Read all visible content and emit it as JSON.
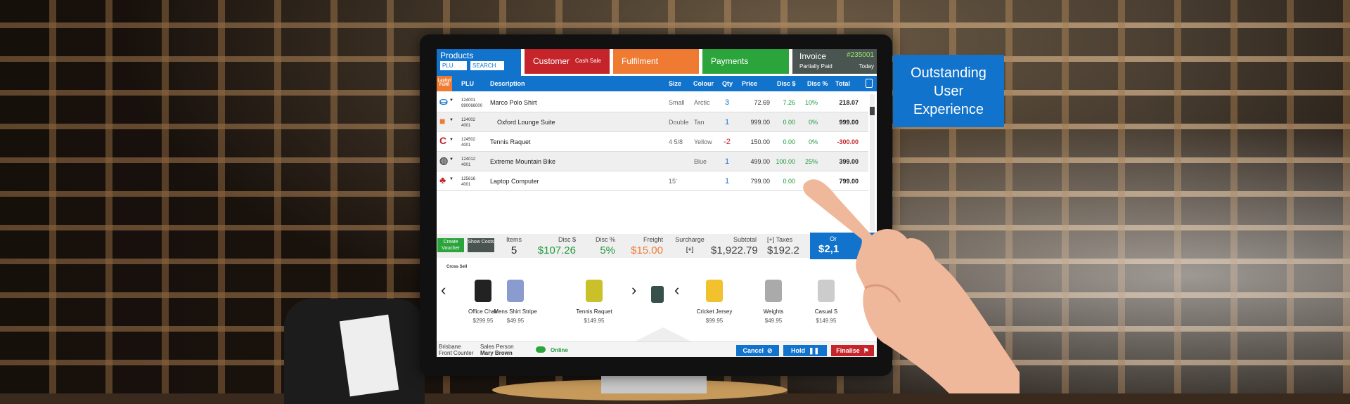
{
  "callout": {
    "line1": "Outstanding",
    "line2": "User",
    "line3": "Experience"
  },
  "tabs": {
    "products": {
      "label": "Products",
      "plu": "PLU",
      "search": "SEARCH",
      "color": "#1173cc"
    },
    "customer": {
      "label": "Customer",
      "sub": "Cash Sale",
      "color": "#c4242a"
    },
    "fulfilment": {
      "label": "Fulfilment",
      "color": "#ef7b33"
    },
    "payments": {
      "label": "Payments",
      "color": "#2ca43c"
    },
    "invoice": {
      "label": "Invoice",
      "number": "#235001",
      "status": "Partially Paid",
      "date": "Today",
      "color": "#4a5552"
    }
  },
  "columns": {
    "layby": "Layby/ Fulfil",
    "plu": "PLU",
    "description": "Description",
    "size": "Size",
    "colour": "Colour",
    "qty": "Qty",
    "price": "Price",
    "disc_amt": "Disc $",
    "disc_pct": "Disc %",
    "total": "Total"
  },
  "rows": [
    {
      "icon": "basket-icon",
      "plu1": "124001",
      "plu2": "990066000",
      "desc": "Marco Polo Shirt",
      "size": "Small",
      "colour": "Arctic",
      "qty": "3",
      "price": "72.69",
      "disc": "7.26",
      "pct": "10%",
      "total": "218.07"
    },
    {
      "icon": "truck-icon",
      "plu1": "124002",
      "plu2": "4001",
      "desc": "Oxford Lounge Suite",
      "size": "Double",
      "colour": "Tan",
      "qty": "1",
      "price": "999.00",
      "disc": "0.00",
      "pct": "0%",
      "total": "999.00"
    },
    {
      "icon": "return-icon",
      "plu1": "124502",
      "plu2": "4001",
      "desc": "Tennis Raquet",
      "size": "4 5/8",
      "colour": "Yellow",
      "qty": "-2",
      "price": "150.00",
      "disc": "0.00",
      "pct": "0%",
      "total": "-300.00"
    },
    {
      "icon": "globe-icon",
      "plu1": "124012",
      "plu2": "4001",
      "desc": "Extreme Mountain Bike",
      "size": "",
      "colour": "Blue",
      "qty": "1",
      "price": "499.00",
      "disc": "100.00",
      "pct": "25%",
      "total": "399.00"
    },
    {
      "icon": "people-icon",
      "plu1": "125616",
      "plu2": "4001",
      "desc": "Laptop Computer",
      "size": "15'",
      "colour": "",
      "qty": "1",
      "price": "799.00",
      "disc": "0.00",
      "pct": "",
      "total": "799.00"
    }
  ],
  "summary": {
    "create_voucher": "Create Voucher",
    "show_costs": "Show Costs",
    "items_label": "Items",
    "items": "5",
    "disc_label": "Disc $",
    "disc": "$107.26",
    "pct_label": "Disc %",
    "pct": "5%",
    "freight_label": "Freight",
    "freight": "$15.00",
    "surcharge_label": "Surcharge",
    "surcharge": "[+]",
    "subtotal_label": "Subtotal",
    "subtotal": "$1,922.79",
    "taxes_label": "[+] Taxes",
    "taxes": "$192.2",
    "order_label": "Or",
    "order": "$2,1"
  },
  "cross_sell": {
    "title": "Cross Sell",
    "items": [
      {
        "name": "Office Chair",
        "price": "$299.95"
      },
      {
        "name": "Mens Shirt Stripe",
        "price": "$49.95"
      },
      {
        "name": "Tennis Raquet",
        "price": "$149.95"
      },
      {
        "name": "Cricket Jersey",
        "price": "$99.95"
      },
      {
        "name": "Weights",
        "price": "$49.95"
      },
      {
        "name": "Casual S",
        "price": "$149.95"
      }
    ]
  },
  "footer": {
    "location1": "Brisbane",
    "location2": "Front Counter",
    "sp_label": "Sales Person",
    "sp_name": "Mary Brown",
    "status": "Online",
    "cancel": "Cancel",
    "hold": "Hold",
    "finalise": "Finalise"
  }
}
